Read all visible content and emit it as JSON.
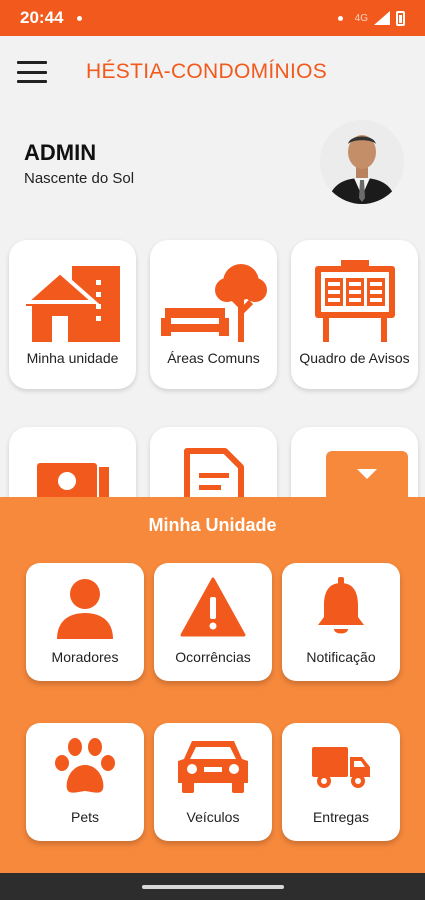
{
  "status_bar": {
    "time": "20:44",
    "network": "4G"
  },
  "app_bar": {
    "title": "HÉSTIA-CONDOMÍNIOS"
  },
  "profile": {
    "name": "ADMIN",
    "subtitle": "Nascente do Sol"
  },
  "main_grid": {
    "items": [
      {
        "label": "Minha unidade",
        "icon": "house-building-icon"
      },
      {
        "label": "Áreas Comuns",
        "icon": "bench-tree-icon"
      },
      {
        "label": "Quadro de Avisos",
        "icon": "notice-board-icon"
      },
      {
        "label": "",
        "icon": "camera-icon"
      },
      {
        "label": "",
        "icon": "document-icon"
      },
      {
        "label": "",
        "icon": "clipboard-icon"
      }
    ]
  },
  "sheet": {
    "title": "Minha Unidade",
    "items": [
      {
        "label": "Moradores",
        "icon": "person-icon"
      },
      {
        "label": "Ocorrências",
        "icon": "warning-icon"
      },
      {
        "label": "Notificação",
        "icon": "bell-icon"
      },
      {
        "label": "Pets",
        "icon": "paw-icon"
      },
      {
        "label": "Veículos",
        "icon": "car-icon"
      },
      {
        "label": "Entregas",
        "icon": "truck-icon"
      }
    ]
  },
  "colors": {
    "accent": "#f25a1d",
    "sheet": "#f7893c",
    "background": "#f2f2f2"
  }
}
